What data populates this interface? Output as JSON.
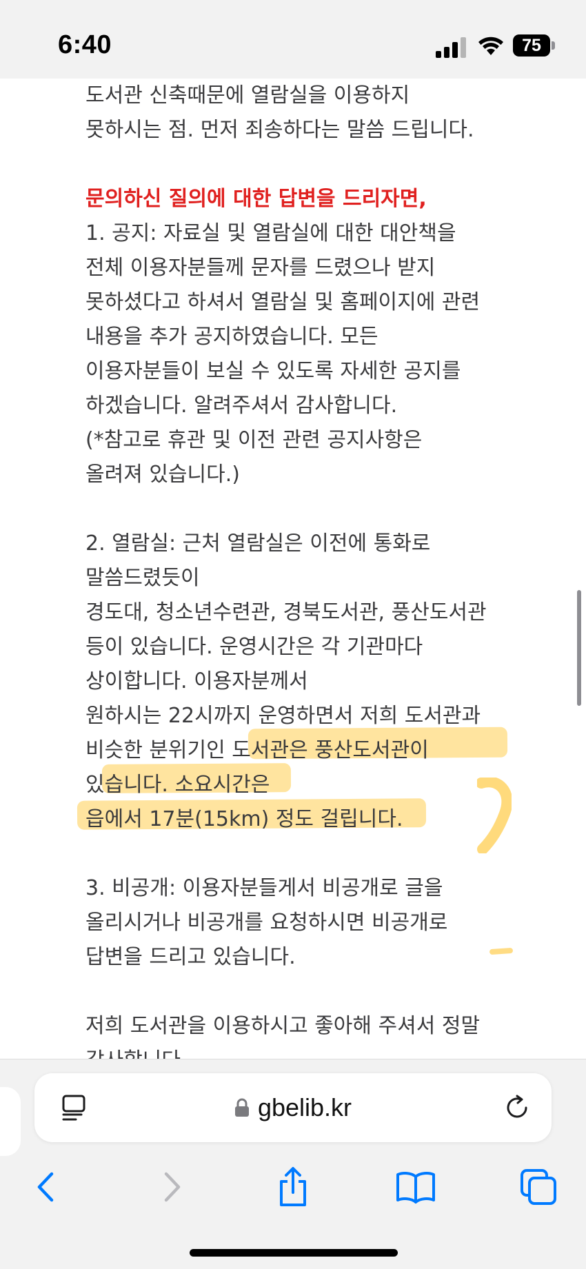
{
  "status_bar": {
    "time": "6:40",
    "battery_level": "75",
    "signal_icon": "cellular-signal-icon",
    "wifi_icon": "wifi-icon",
    "battery_icon": "battery-icon"
  },
  "article": {
    "lines": [
      "도서관 신축때문에 열람실을 이용하지",
      "못하시는 점. 먼저 죄송하다는 말씀 드립니다.",
      "",
      "문의하신 질의에 대한 답변을 드리자면,",
      "1. 공지: 자료실 및 열람실에 대한 대안책을",
      "전체 이용자분들께 문자를 드렸으나 받지",
      "못하셨다고 하셔서 열람실 및 홈페이지에 관련",
      "내용을 추가 공지하였습니다. 모든",
      "이용자분들이 보실 수 있도록 자세한 공지를",
      "하겠습니다. 알려주셔서 감사합니다.",
      "(*참고로 휴관 및 이전 관련 공지사항은",
      "올려져 있습니다.)",
      "",
      "2. 열람실: 근처 열람실은 이전에 통화로",
      "말씀드렸듯이",
      "경도대, 청소년수련관, 경북도서관, 풍산도서관",
      "등이 있습니다. 운영시간은 각 기관마다",
      "상이합니다. 이용자분께서",
      "원하시는 22시까지 운영하면서 저희 도서관과",
      "비슷한 분위기인 도서관은 풍산도서관이",
      "있습니다. 소요시간은",
      "읍에서 17분(15km) 정도 걸립니다.",
      "",
      "3. 비공개: 이용자분들게서 비공개로 글을",
      "올리시거나 비공개를 요청하시면 비공개로",
      "답변을 드리고 있습니다.",
      "",
      "저희 도서관을 이용하시고 좋아해 주셔서 정말",
      "감사합니다"
    ],
    "highlight_color": "#FFCD50",
    "answer_heading_color": "#E0201F"
  },
  "browser": {
    "url": "gbelib.kr",
    "reader_icon": "reader-page-icon",
    "lock_icon": "lock-icon",
    "reload_icon": "reload-icon",
    "toolbar": {
      "back_icon": "chevron-left-icon",
      "forward_icon": "chevron-right-icon",
      "share_icon": "share-icon",
      "bookmarks_icon": "book-icon",
      "tabs_icon": "tabs-icon"
    },
    "accent_color": "#007AFF"
  }
}
